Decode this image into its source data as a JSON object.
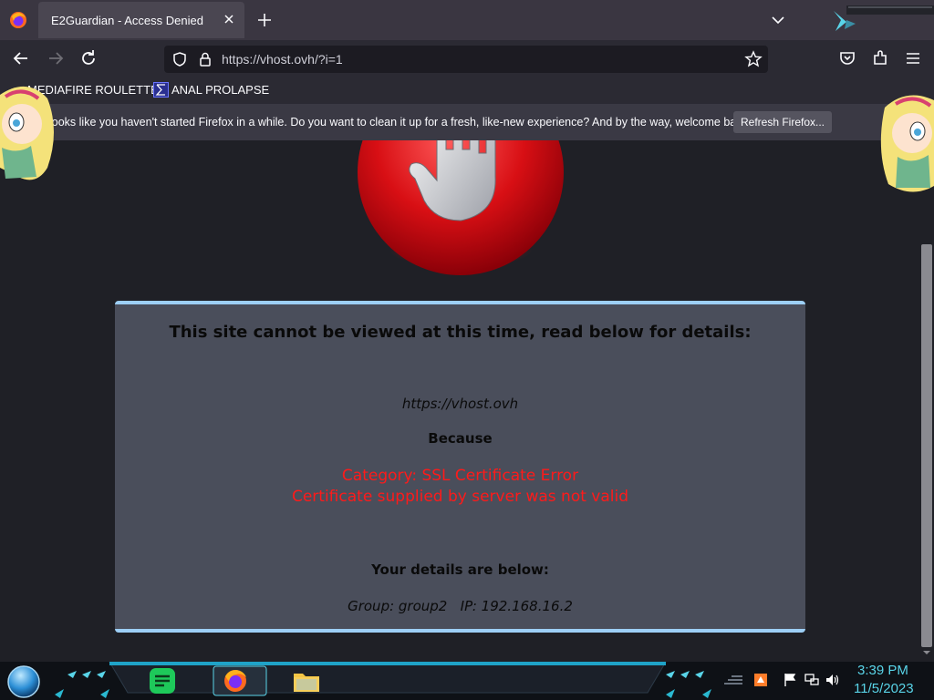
{
  "browser": {
    "tab": {
      "title": "E2Guardian - Access Denied"
    },
    "url": "https://vhost.ovh/?i=1",
    "bookmarks": [
      "MEDIAFIRE ROULETTER",
      "ANAL PROLAPSE"
    ],
    "notification": {
      "text": "looks like you haven't started Firefox in a while. Do you want to clean it up for a fresh, like-new experience? And by the way, welcome back!",
      "button": "Refresh Firefox..."
    }
  },
  "page": {
    "headline": "This site cannot be viewed at this time, read below for details:",
    "blocked_url": "https://vhost.ovh",
    "because": "Because",
    "category": "Category: SSL Certificate Error",
    "reason": "Certificate supplied by server was not valid",
    "details_heading": "Your details are below:",
    "details_line": "Group: group2   IP: 192.168.16.2"
  },
  "taskbar": {
    "time": "3:39 PM",
    "date": "11/5/2023"
  },
  "colors": {
    "accent_teal": "#59d4e8",
    "error_red": "#ff1a1a",
    "box_border": "#9dcff6"
  }
}
